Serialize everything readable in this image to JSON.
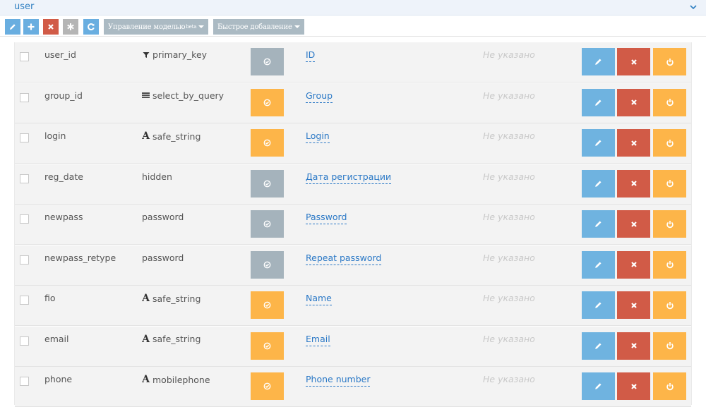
{
  "header": {
    "title": "user",
    "collapse_icon": "chevron-down-icon"
  },
  "toolbar": {
    "buttons": [
      {
        "icon": "pencil-icon",
        "color": "#69aee0"
      },
      {
        "icon": "plus-icon",
        "color": "#69aee0"
      },
      {
        "icon": "times-icon",
        "color": "#d15b47"
      },
      {
        "icon": "asterisk-icon",
        "color": "#b5b5b5"
      },
      {
        "icon": "refresh-icon",
        "color": "#69aee0"
      }
    ],
    "model_menu_label": "Управление моделью",
    "model_menu_badge": "beta",
    "quick_add_label": "Быстрое добавление"
  },
  "rows": [
    {
      "name": "user_id",
      "type": "primary_key",
      "type_icon": "filter-icon",
      "status_color": "gray",
      "label": "ID",
      "description": "Не указано"
    },
    {
      "name": "group_id",
      "type": "select_by_query",
      "type_icon": "list-icon",
      "status_color": "orange",
      "label": "Group",
      "description": "Не указано"
    },
    {
      "name": "login",
      "type": "safe_string",
      "type_icon": "font-icon",
      "status_color": "orange",
      "label": "Login",
      "description": "Не указано"
    },
    {
      "name": "reg_date",
      "type": "hidden",
      "type_icon": "",
      "status_color": "gray",
      "label": "Дата регистрации",
      "description": "Не указано"
    },
    {
      "name": "newpass",
      "type": "password",
      "type_icon": "",
      "status_color": "gray",
      "label": "Password",
      "description": "Не указано"
    },
    {
      "name": "newpass_retype",
      "type": "password",
      "type_icon": "",
      "status_color": "gray",
      "label": "Repeat password",
      "description": "Не указано"
    },
    {
      "name": "fio",
      "type": "safe_string",
      "type_icon": "font-icon",
      "status_color": "orange",
      "label": "Name",
      "description": "Не указано"
    },
    {
      "name": "email",
      "type": "safe_string",
      "type_icon": "font-icon",
      "status_color": "orange",
      "label": "Email",
      "description": "Не указано"
    },
    {
      "name": "phone",
      "type": "mobilephone",
      "type_icon": "font-icon",
      "status_color": "orange",
      "label": "Phone number",
      "description": "Не указано"
    }
  ],
  "colors": {
    "blue": "#6fb3e0",
    "red": "#d15b47",
    "orange": "#fdb549",
    "gray": "#a5b3bc",
    "link": "#2a78c6"
  }
}
